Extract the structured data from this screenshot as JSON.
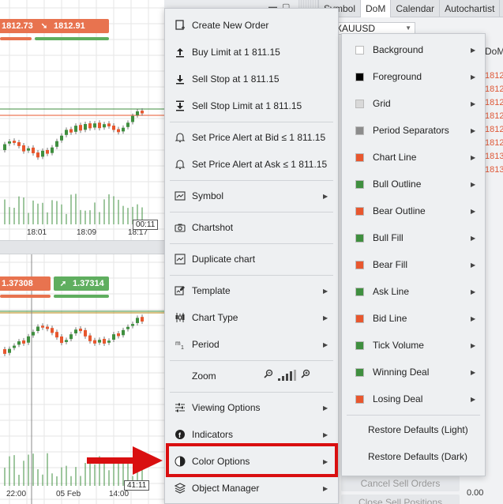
{
  "window": {
    "tabs": [
      {
        "label": "Symbol",
        "active": false
      },
      {
        "label": "DoM",
        "active": true
      },
      {
        "label": "Calendar",
        "active": false
      },
      {
        "label": "Autochartist",
        "active": false
      }
    ],
    "symbol": "XAUUSD",
    "dom_label": "DoM",
    "dom_prices": [
      "1812",
      "1812",
      "1812",
      "1812",
      "1812",
      "1812",
      "1813",
      "1813"
    ],
    "bottom": {
      "cancel_sell": "Cancel Sell Orders",
      "close_sell": "Close Sell Positions",
      "value": "0.00"
    }
  },
  "chart_top": {
    "sell_price": "1812.73",
    "buy_price": "1812.91",
    "time_labels": [
      "18:01",
      "18:09",
      "18:17"
    ],
    "cursor_time": "00:11"
  },
  "chart_bottom": {
    "sell_price": "1.37308",
    "buy_price": "1.37314",
    "time_labels": [
      "22:00",
      "05 Feb",
      "14:00"
    ],
    "cursor_time": "41:11"
  },
  "context_menu": {
    "items": [
      {
        "id": "create-new-order",
        "label": "Create New Order",
        "icon": "new-order-icon",
        "submenu": false
      },
      {
        "id": "buy-limit",
        "label": "Buy Limit at 1 811.15",
        "icon": "arrow-up-icon",
        "submenu": false
      },
      {
        "id": "sell-stop",
        "label": "Sell Stop at 1 811.15",
        "icon": "arrow-down-icon",
        "submenu": false
      },
      {
        "id": "sell-stop-limit",
        "label": "Sell Stop Limit at 1 811.15",
        "icon": "arrow-down-icon",
        "submenu": false
      },
      {
        "id": "price-alert-bid",
        "label": "Set Price Alert at Bid ≤ 1 811.15",
        "icon": "bell-icon",
        "submenu": false
      },
      {
        "id": "price-alert-ask",
        "label": "Set Price Alert at Ask ≤ 1 811.15",
        "icon": "bell-icon",
        "submenu": false
      },
      {
        "id": "symbol",
        "label": "Symbol",
        "icon": "chart-icon",
        "submenu": true
      },
      {
        "id": "chartshot",
        "label": "Chartshot",
        "icon": "camera-icon",
        "submenu": false
      },
      {
        "id": "duplicate-chart",
        "label": "Duplicate chart",
        "icon": "duplicate-icon",
        "submenu": false
      },
      {
        "id": "template",
        "label": "Template",
        "icon": "template-icon",
        "submenu": true
      },
      {
        "id": "chart-type",
        "label": "Chart Type",
        "icon": "candles-icon",
        "submenu": true
      },
      {
        "id": "period",
        "label": "Period",
        "icon": "period-icon",
        "submenu": true
      },
      {
        "id": "zoom",
        "label": "Zoom",
        "icon": "",
        "submenu": false
      },
      {
        "id": "viewing-options",
        "label": "Viewing Options",
        "icon": "sliders-icon",
        "submenu": true
      },
      {
        "id": "indicators",
        "label": "Indicators",
        "icon": "indicators-icon",
        "submenu": true
      },
      {
        "id": "color-options",
        "label": "Color Options",
        "icon": "palette-icon",
        "submenu": true
      },
      {
        "id": "object-manager",
        "label": "Object Manager",
        "icon": "layers-icon",
        "submenu": true
      }
    ]
  },
  "color_submenu": {
    "items": [
      {
        "label": "Background",
        "color": "#ffffff"
      },
      {
        "label": "Foreground",
        "color": "#000000"
      },
      {
        "label": "Grid",
        "color": "#d9d9d9"
      },
      {
        "label": "Period Separators",
        "color": "#8c8c8c"
      },
      {
        "label": "Chart Line",
        "color": "#e8572e"
      },
      {
        "label": "Bull Outline",
        "color": "#3f8f3f"
      },
      {
        "label": "Bear Outline",
        "color": "#e8572e"
      },
      {
        "label": "Bull Fill",
        "color": "#3f8f3f"
      },
      {
        "label": "Bear Fill",
        "color": "#e8572e"
      },
      {
        "label": "Ask Line",
        "color": "#3f8f3f"
      },
      {
        "label": "Bid Line",
        "color": "#e8572e"
      },
      {
        "label": "Tick Volume",
        "color": "#3f8f3f"
      },
      {
        "label": "Winning Deal",
        "color": "#3f8f3f"
      },
      {
        "label": "Losing Deal",
        "color": "#e8572e"
      }
    ],
    "restore_light": "Restore Defaults (Light)",
    "restore_dark": "Restore Defaults (Dark)"
  }
}
